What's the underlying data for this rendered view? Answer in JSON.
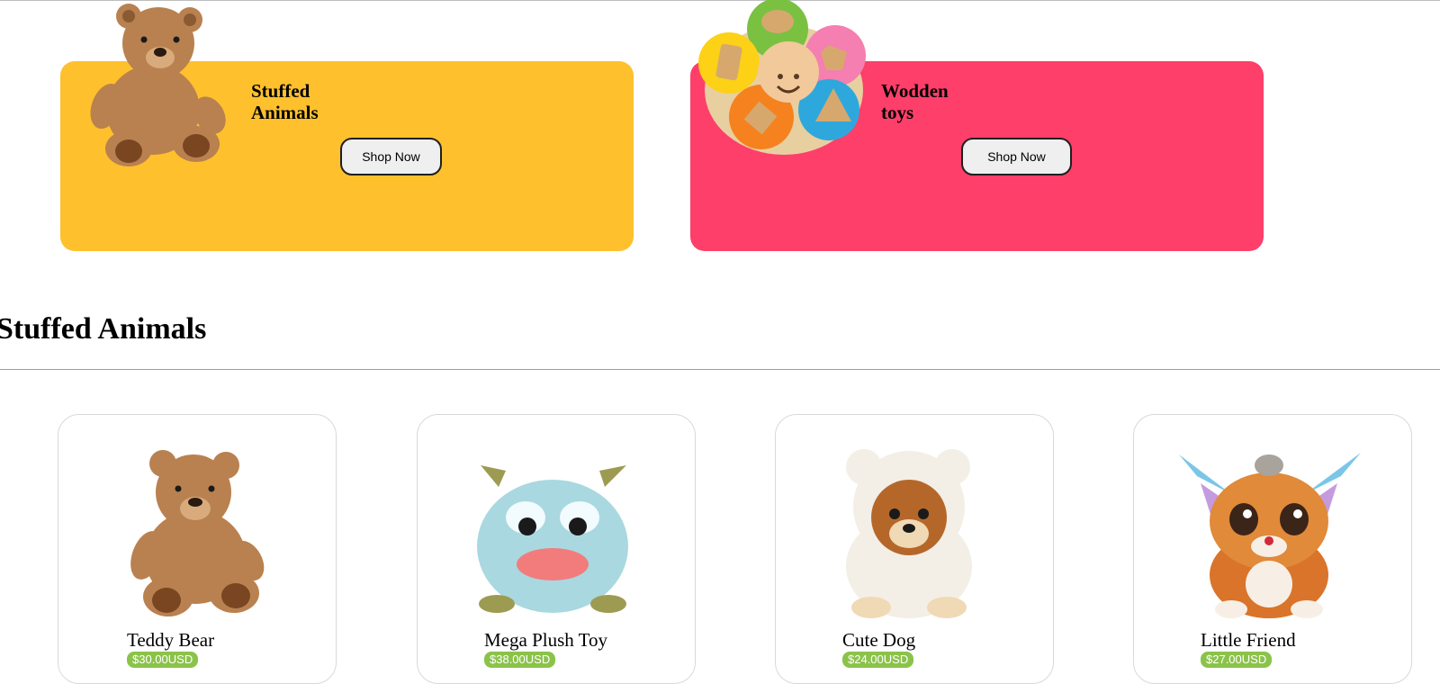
{
  "banners": [
    {
      "title": "Stuffed\nAnimals",
      "button": "Shop Now",
      "color": "#fec02d"
    },
    {
      "title": "Wodden\ntoys",
      "button": "Shop Now",
      "color": "#fe3f6a"
    }
  ],
  "section": {
    "title": "Stuffed Animals"
  },
  "products": [
    {
      "name": "Teddy Bear",
      "price": "$30.00USD"
    },
    {
      "name": "Mega Plush Toy",
      "price": "$38.00USD"
    },
    {
      "name": "Cute Dog",
      "price": "$24.00USD"
    },
    {
      "name": "Little Friend",
      "price": "$27.00USD"
    }
  ],
  "colors": {
    "price_badge": "#8bc34a"
  }
}
